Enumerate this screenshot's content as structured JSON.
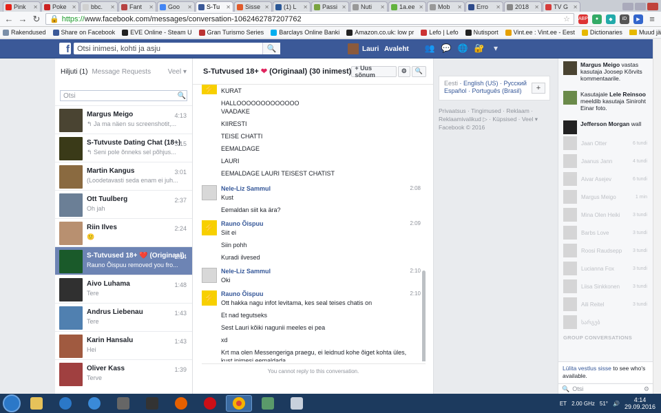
{
  "tabs": [
    {
      "label": "Pink",
      "color": "#e62117",
      "active": false
    },
    {
      "label": "Poke",
      "color": "#cc2222",
      "active": false
    },
    {
      "label": "bbc.",
      "color": "#d0d0d0",
      "active": false
    },
    {
      "label": "Fant",
      "color": "#b74242",
      "active": false
    },
    {
      "label": "Goo",
      "color": "#4285f4",
      "active": false
    },
    {
      "label": "S-Tu",
      "color": "#3b5998",
      "active": true
    },
    {
      "label": "Sisse",
      "color": "#e05a2b",
      "active": false
    },
    {
      "label": "(1) L",
      "color": "#2b5797",
      "active": false
    },
    {
      "label": "Passi",
      "color": "#7aa340",
      "active": false
    },
    {
      "label": "Nuti",
      "color": "#999999",
      "active": false
    },
    {
      "label": "1a.ee",
      "color": "#63b33e",
      "active": false
    },
    {
      "label": "Mob",
      "color": "#999999",
      "active": false
    },
    {
      "label": "Erro",
      "color": "#2e4a8a",
      "active": false
    },
    {
      "label": "2018",
      "color": "#888888",
      "active": false
    },
    {
      "label": "TV G",
      "color": "#d63c3c",
      "active": false
    }
  ],
  "browser": {
    "url_scheme": "https://",
    "url_rest": "www.facebook.com/messages/conversation-1062462787207762"
  },
  "bookmarks": [
    {
      "label": "Rakendused",
      "color": "#7b8fa8"
    },
    {
      "label": "Share on Facebook",
      "color": "#3b5998"
    },
    {
      "label": "EVE Online - Steam U",
      "color": "#222222"
    },
    {
      "label": "Gran Turismo Series",
      "color": "#b33"
    },
    {
      "label": "Barclays Online Banki",
      "color": "#00aeef"
    },
    {
      "label": "Amazon.co.uk: low pr",
      "color": "#222222"
    },
    {
      "label": "Lefo | Lefo",
      "color": "#cc3333"
    },
    {
      "label": "Nutisport",
      "color": "#222222"
    },
    {
      "label": "Vint.ee : Vint.ee - Eest",
      "color": "#e6a000"
    },
    {
      "label": "Dictionaries",
      "color": "#e6b800"
    }
  ],
  "bookmarks_other": "Muud järjehoidjad",
  "fb": {
    "search_placeholder": "Otsi inimesi, kohti ja asju",
    "user_name": "Lauri",
    "home_label": "Avaleht"
  },
  "left": {
    "inbox_label": "Hiljuti",
    "inbox_count": "(1)",
    "requests_label": "Message Requests",
    "more_label": "Veel",
    "search_placeholder": "Otsi",
    "conversations": [
      {
        "name": "Margus Meigo",
        "snippet": "↰ Ja ma näen su screenshotit,...",
        "time": "4:13",
        "color": "#4a4432",
        "active": false
      },
      {
        "name": "S-Tutvuste Dating Chat (18+)",
        "snippet": "↰ Seni pole õnneks sel põhjus...",
        "time": "3:15",
        "color": "#3a3a18",
        "active": false
      },
      {
        "name": "Martin Kangus",
        "snippet": "(Loodetavasti seda enam ei juh...",
        "time": "3:01",
        "color": "#8a6a40",
        "active": false
      },
      {
        "name": "Ott Tuulberg",
        "snippet": "Oh jah",
        "time": "2:37",
        "color": "#6b7f96",
        "active": false
      },
      {
        "name": "Riin Ilves",
        "snippet": "🙂",
        "time": "2:24",
        "color": "#b89070",
        "active": false
      },
      {
        "name": "S-Tutvused 18+ ❤️ (Originaal)",
        "snippet": "Rauno Õispuu removed you fro...",
        "time": "2:14",
        "color": "#1a5a2a",
        "active": true
      },
      {
        "name": "Aivo Luhama",
        "snippet": "Tere",
        "time": "1:48",
        "color": "#303030",
        "active": false
      },
      {
        "name": "Andrus Liebenau",
        "snippet": "Tere",
        "time": "1:43",
        "color": "#5080b0",
        "active": false
      },
      {
        "name": "Karin Hansalu",
        "snippet": "Hei",
        "time": "1:43",
        "color": "#a05a40",
        "active": false
      },
      {
        "name": "Oliver Kass",
        "snippet": "Terve",
        "time": "1:39",
        "color": "#a04040",
        "active": false
      }
    ]
  },
  "conversation": {
    "title": "S-Tutvused 18+",
    "heart": "❤",
    "title_suffix": "(Originaal) (30 inimest)",
    "new_message_label": "+ Uus sõnum",
    "plain_lines_top": [
      "KURAT",
      "HALLOOOOOOOOOOOOO",
      "VAADAKE",
      "KIIRESTI",
      "TEISE CHATTI",
      "EEMALDAGE",
      "LAURI",
      "EEMALDAGE LAURI TEISEST CHATIST"
    ],
    "blocks": [
      {
        "sender": "Nele-Liz Sammul",
        "time": "2:08",
        "kind": "photo",
        "lines": [
          "Kust",
          "Eemaldan siit ka ära?"
        ]
      },
      {
        "sender": "Rauno Õispuu",
        "time": "2:09",
        "kind": "warn",
        "lines": [
          "Siit ei",
          "Siin pohh",
          "Kuradi ilvesed"
        ]
      },
      {
        "sender": "Nele-Liz Sammul",
        "time": "2:10",
        "kind": "photo",
        "lines": [
          "Oki"
        ]
      },
      {
        "sender": "Rauno Õispuu",
        "time": "2:10",
        "kind": "warn",
        "lines": [
          "Ott hakka nagu infot levitama, kes seal teises chatis on",
          "Et nad tegutseks",
          "Sest Lauri kõiki nagunii meeles ei pea",
          "xd",
          "Krt ma olen Messengeriga praegu, ei leidnud kohe õiget kohta üles,",
          "kust inimesi eemaldada"
        ]
      }
    ],
    "cannot_reply": "You cannot reply to this conversation."
  },
  "right": {
    "lang_current": "Eesti",
    "lang_line1": "English (US) · Русский",
    "lang_line2": "Español · Português (Brasil)",
    "links_line1": "Privaatsus · Tingimused · Reklaam ·",
    "links_line2": "Reklaamivalikud ▷ · Küpsised · Veel ▾",
    "copyright": "Facebook © 2016"
  },
  "ticker": [
    {
      "name": "Margus Meigo",
      "text": " vastas kasutaja Joosep Kõrvits kommentaarile.",
      "color": "#4a4432",
      "prefix": ""
    },
    {
      "name": "Lele Reinsoo",
      "text": " meeldib kasutaja Siniroht Einar foto.",
      "color": "#6a8a4a",
      "prefix": "Kasutajale "
    },
    {
      "name": "Jefferson Morgan",
      "text": " wall",
      "color": "#222222",
      "prefix": ""
    }
  ],
  "chat_sidebar": {
    "contacts": [
      {
        "name": "Jaan Otter",
        "time": "6 tundi"
      },
      {
        "name": "Jaanus Jann",
        "time": "4 tundi"
      },
      {
        "name": "Aivar Asejev",
        "time": "6 tundi"
      },
      {
        "name": "Margus Meigo",
        "time": "1 min"
      },
      {
        "name": "Mina Olen Heiki",
        "time": "3 tundi"
      },
      {
        "name": "Barbs Love",
        "time": "3 tundi"
      },
      {
        "name": "Roosi Raudsepp",
        "time": "3 tundi"
      },
      {
        "name": "Lucianna Fox",
        "time": "3 tundi"
      },
      {
        "name": "Liisa Sinkkonen",
        "time": "3 tundi"
      },
      {
        "name": "Aili Reitel",
        "time": "3 tundi"
      },
      {
        "name": "სარგებ",
        "time": ""
      }
    ],
    "group_label": "GROUP CONVERSATIONS",
    "turn_on_link": "Lülita vestlus sisse",
    "turn_on_rest": " to see who's available.",
    "search_placeholder": "Otsi"
  },
  "taskbar": {
    "lang": "ET",
    "cpu": "2.00 GHz",
    "temp": "51°",
    "time": "4:14",
    "date": "29.09.2016"
  },
  "colors": {
    "fb_blue": "#3b5998",
    "active_conv": "#6d84b4",
    "link": "#365899"
  }
}
